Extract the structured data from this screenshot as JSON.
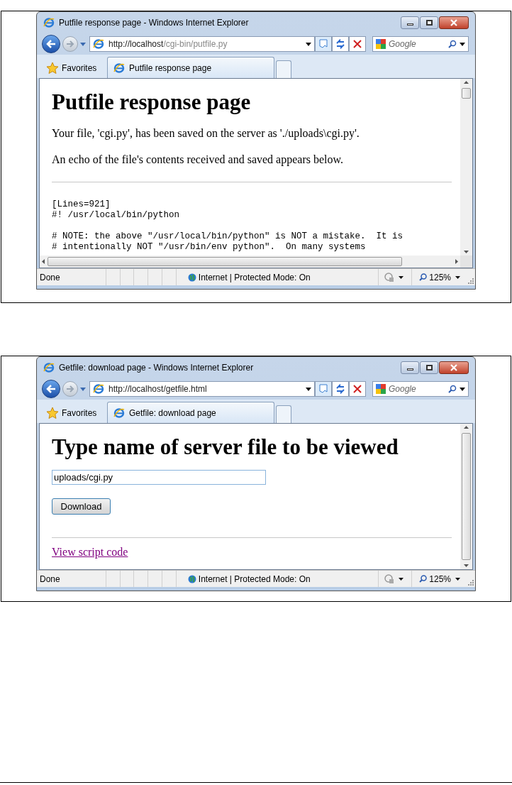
{
  "figures": [
    {
      "title": "Putfile response page - Windows Internet Explorer",
      "address_host": "http://localhost",
      "address_path": "/cgi-bin/putfile.py",
      "address_dim": true,
      "search_placeholder": "Google",
      "favorites": "Favorites",
      "tab": "Putfile response page",
      "horizontal_scrollbar": true,
      "content": [
        {
          "kind": "heading",
          "text": "Putfile response page"
        },
        {
          "kind": "paragraph",
          "text": "Your file, 'cgi.py', has been saved on the server as './uploads\\cgi.py'."
        },
        {
          "kind": "paragraph",
          "text": "An echo of the file's contents received and saved appears below."
        },
        {
          "kind": "rule"
        },
        {
          "kind": "code",
          "lines": [
            "[Lines=921]",
            "#! /usr/local/bin/python"
          ]
        },
        {
          "kind": "code",
          "lines": [
            "# NOTE: the above \"/usr/local/bin/python\" is NOT a mistake.  It is",
            "# intentionally NOT \"/usr/bin/env python\".  On many systems"
          ]
        }
      ],
      "status": {
        "text": "Done",
        "zone": "Internet | Protected Mode: On",
        "zoom": "125%"
      }
    },
    {
      "title": "Getfile: download page - Windows Internet Explorer",
      "address_host": "http://localhost",
      "address_path": "/getfile.html",
      "address_dim": false,
      "search_placeholder": "Google",
      "favorites": "Favorites",
      "tab": "Getfile: download page",
      "horizontal_scrollbar": false,
      "content": [
        {
          "kind": "heading",
          "text": "Type name of server file to be viewed"
        },
        {
          "kind": "field",
          "value": "uploads/cgi.py"
        },
        {
          "kind": "button",
          "text": "Download"
        },
        {
          "kind": "rule"
        },
        {
          "kind": "link",
          "text": "View script code"
        }
      ],
      "status": {
        "text": "Done",
        "zone": "Internet | Protected Mode: On",
        "zoom": "125%"
      }
    }
  ]
}
